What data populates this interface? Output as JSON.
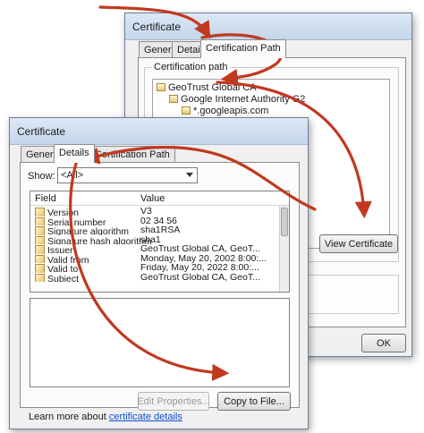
{
  "back_dialog": {
    "title": "Certificate",
    "tabs": [
      "General",
      "Details",
      "Certification Path"
    ],
    "group_label": "Certification path",
    "path_items": [
      "GeoTrust Global CA",
      "Google Internet Authority G2",
      "*.googleapis.com"
    ],
    "view_certificate_label": "View Certificate",
    "ok_label": "OK"
  },
  "front_dialog": {
    "title": "Certificate",
    "tabs": [
      "General",
      "Details",
      "Certification Path"
    ],
    "show_label": "Show:",
    "show_value": "<All>",
    "columns": [
      "Field",
      "Value"
    ],
    "fields": [
      {
        "field": "Version",
        "value": "V3"
      },
      {
        "field": "Serial number",
        "value": "02 34 56"
      },
      {
        "field": "Signature algorithm",
        "value": "sha1RSA"
      },
      {
        "field": "Signature hash algorithm",
        "value": "sha1"
      },
      {
        "field": "Issuer",
        "value": "GeoTrust Global CA, GeoT..."
      },
      {
        "field": "Valid from",
        "value": "Monday, May 20, 2002 8:00:..."
      },
      {
        "field": "Valid to",
        "value": "Friday, May 20, 2022 8:00:..."
      },
      {
        "field": "Subject",
        "value": "GeoTrust Global CA, GeoT..."
      }
    ],
    "edit_properties_label": "Edit Properties...",
    "copy_to_file_label": "Copy to File...",
    "learn_more_prefix": "Learn more about",
    "learn_more_link": "certificate details"
  },
  "annotation_color": "#c0391f"
}
